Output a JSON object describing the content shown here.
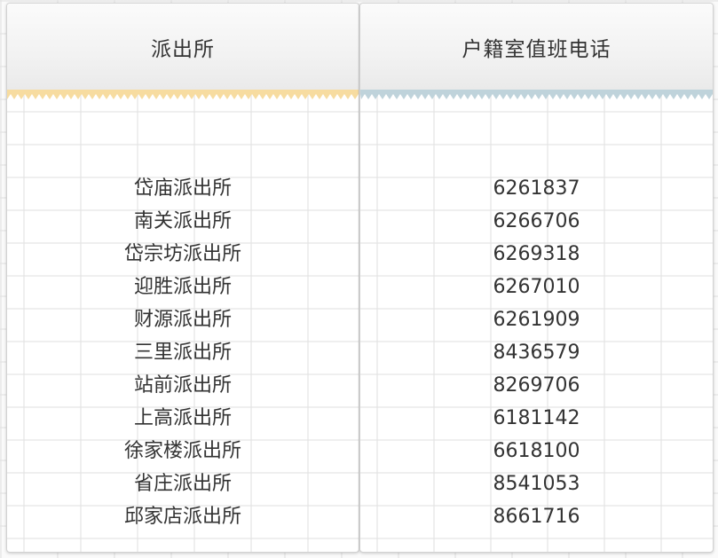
{
  "table": {
    "headers": [
      "派出所",
      "户籍室值班电话"
    ],
    "accent_colors": [
      "#f7dca0",
      "#bfd3db"
    ],
    "rows": [
      {
        "station": "岱庙派出所",
        "phone": "6261837"
      },
      {
        "station": "南关派出所",
        "phone": "6266706"
      },
      {
        "station": "岱宗坊派出所",
        "phone": "6269318"
      },
      {
        "station": "迎胜派出所",
        "phone": "6267010"
      },
      {
        "station": "财源派出所",
        "phone": "6261909"
      },
      {
        "station": "三里派出所",
        "phone": "8436579"
      },
      {
        "station": "站前派出所",
        "phone": "8269706"
      },
      {
        "station": "上高派出所",
        "phone": "6181142"
      },
      {
        "station": "徐家楼派出所",
        "phone": "6618100"
      },
      {
        "station": "省庄派出所",
        "phone": "8541053"
      },
      {
        "station": "邱家店派出所",
        "phone": "8661716"
      }
    ]
  }
}
